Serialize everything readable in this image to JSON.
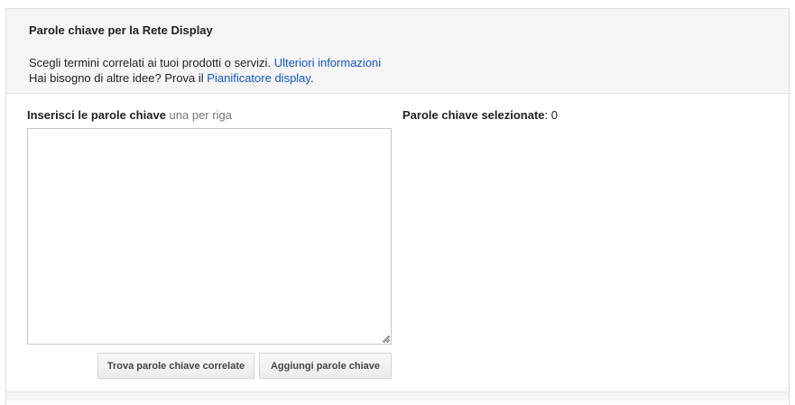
{
  "header": {
    "title": "Parole chiave per la Rete Display",
    "line1_text": "Scegli termini correlati ai tuoi prodotti o servizi.",
    "line1_link": "Ulteriori informazioni",
    "line2_text": "Hai bisogno di altre idee? Prova il",
    "line2_link": "Pianificatore display",
    "line2_suffix": "."
  },
  "input_section": {
    "label": "Inserisci le parole chiave",
    "hint": "una per riga",
    "textarea_value": ""
  },
  "buttons": {
    "find_related": "Trova parole chiave correlate",
    "add_keywords": "Aggiungi parole chiave"
  },
  "selected": {
    "label": "Parole chiave selezionate",
    "separator": ":",
    "count": "0"
  },
  "colors": {
    "link": "#1155cc",
    "header_bg": "#f5f5f5",
    "border": "#e0e0e0"
  }
}
